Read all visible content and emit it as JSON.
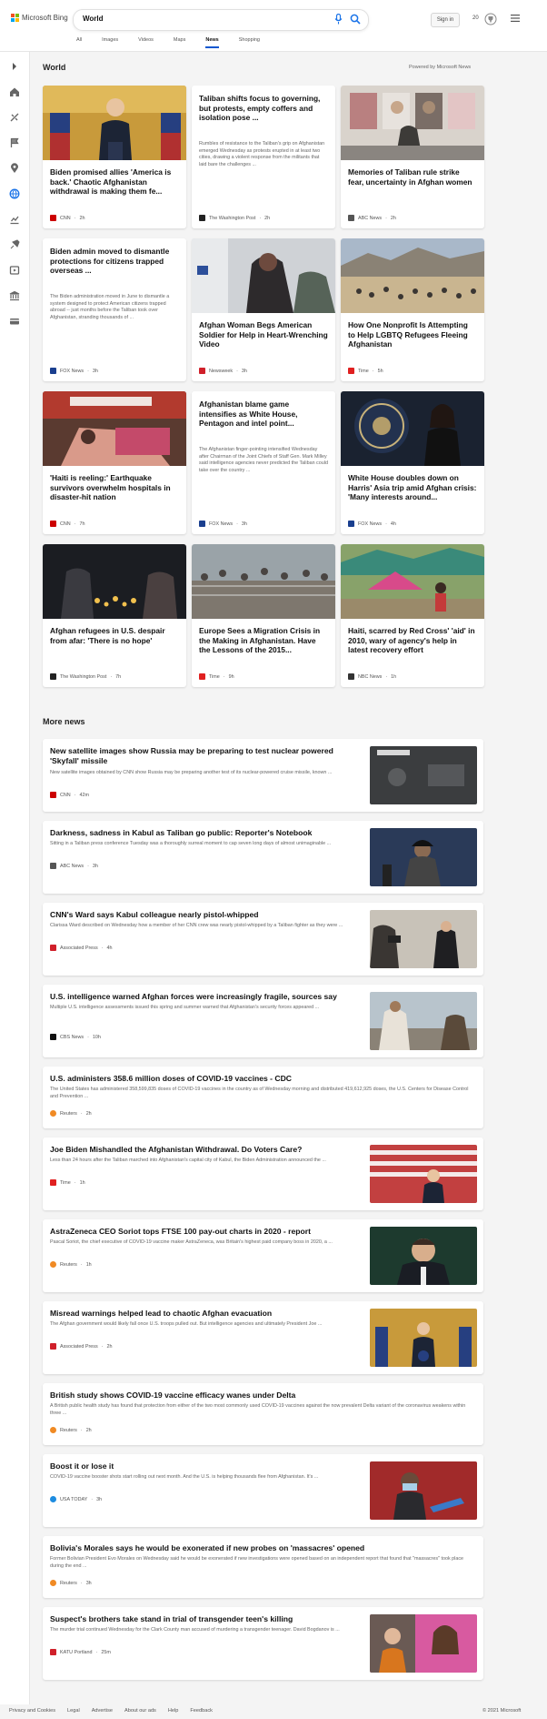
{
  "header": {
    "brand": "Microsoft Bing",
    "search_value": "World",
    "signin_label": "Sign in",
    "rewards_count": "20",
    "tabs": [
      "All",
      "Images",
      "Videos",
      "Maps",
      "News",
      "Shopping"
    ],
    "active_tab": "News"
  },
  "rail": {
    "icons": [
      "expand-icon",
      "home-icon",
      "sports-icon",
      "flag-icon",
      "location-icon",
      "world-icon",
      "business-icon",
      "science-icon",
      "entertainment-icon",
      "politics-icon",
      "money-icon"
    ]
  },
  "top": {
    "section_title": "World",
    "powered": "Powered by Microsoft News",
    "cards": [
      {
        "title": "Biden promised allies 'America is back.' Chaotic Afghanistan withdrawal is making them fe...",
        "source": "CNN",
        "time": "2h",
        "src_color": "#cc0000"
      },
      {
        "title": "Taliban shifts focus to governing, but protests, empty coffers and isolation pose ...",
        "snippet": "Rumbles of resistance to the Taliban's grip on Afghanistan emerged Wednesday as protests erupted in at least two cities, drawing a violent response from the militants that laid bare the challenges ...",
        "source": "The Washington Post",
        "time": "2h",
        "src_color": "#222222"
      },
      {
        "title": "Memories of Taliban rule strike fear, uncertainty in Afghan women",
        "source": "ABC News",
        "time": "2h",
        "src_color": "#555555"
      },
      {
        "title": "Biden admin moved to dismantle protections for citizens trapped overseas ...",
        "snippet": "The Biden administration moved in June to dismantle a system designed to protect American citizens trapped abroad -- just months before the Taliban took over Afghanistan, stranding thousands of ...",
        "source": "FOX News",
        "time": "3h",
        "src_color": "#1a3f8f"
      },
      {
        "title": "Afghan Woman Begs American Soldier for Help in Heart-Wrenching Video",
        "source": "Newsweek",
        "time": "3h",
        "src_color": "#d0202a"
      },
      {
        "title": "How One Nonprofit Is Attempting to Help LGBTQ Refugees Fleeing Afghanistan",
        "source": "Time",
        "time": "5h",
        "src_color": "#e02020"
      },
      {
        "title": "'Haiti is reeling:' Earthquake survivors overwhelm hospitals in disaster-hit nation",
        "source": "CNN",
        "time": "7h",
        "src_color": "#cc0000"
      },
      {
        "title": "Afghanistan blame game intensifies as White House, Pentagon and intel point...",
        "snippet": "The Afghanistan finger-pointing intensified Wednesday after Chairman of the Joint Chiefs of Staff Gen. Mark Milley said intelligence agencies never predicted the Taliban could take over the country ...",
        "source": "FOX News",
        "time": "3h",
        "src_color": "#1a3f8f"
      },
      {
        "title": "White House doubles down on Harris' Asia trip amid Afghan crisis: 'Many interests around...",
        "source": "FOX News",
        "time": "4h",
        "src_color": "#1a3f8f"
      },
      {
        "title": "Afghan refugees in U.S. despair from afar: 'There is no hope'",
        "source": "The Washington Post",
        "time": "7h",
        "src_color": "#222222"
      },
      {
        "title": "Europe Sees a Migration Crisis in the Making in Afghanistan. Have the Lessons of the 2015...",
        "source": "Time",
        "time": "9h",
        "src_color": "#e02020"
      },
      {
        "title": "Haiti, scarred by Red Cross' 'aid' in 2010, wary of agency's help in latest recovery effort",
        "source": "NBC News",
        "time": "1h",
        "src_color": "#333333"
      }
    ]
  },
  "more": {
    "section_title": "More news",
    "items": [
      {
        "title": "New satellite images show Russia may be preparing to test nuclear powered 'Skyfall' missile",
        "snippet": "New satellite images obtained by CNN show Russia may be preparing another test of its nuclear-powered cruise missile, known ...",
        "source": "CNN",
        "time": "42m",
        "src_color": "#cc0000"
      },
      {
        "title": "Darkness, sadness in Kabul as Taliban go public: Reporter's Notebook",
        "snippet": "Sitting in a Taliban press conference Tuesday was a thoroughly surreal moment to cap seven long days of almost unimaginable ...",
        "source": "ABC News",
        "time": "3h",
        "src_color": "#555555"
      },
      {
        "title": "CNN's Ward says Kabul colleague nearly pistol-whipped",
        "snippet": "Clarissa Ward described on Wednesday how a member of her CNN crew was nearly pistol-whipped by a Taliban fighter as they were ...",
        "source": "Associated Press",
        "time": "4h",
        "src_color": "#d0202a"
      },
      {
        "title": "U.S. intelligence warned Afghan forces were increasingly fragile, sources say",
        "snippet": "Multiple U.S. intelligence assessments issued this spring and summer warned that Afghanistan's security forces appeared ...",
        "source": "CBS News",
        "time": "10h",
        "src_color": "#111111"
      },
      {
        "title": "U.S. administers 358.6 million doses of COVID-19 vaccines - CDC",
        "snippet": "The United States has administered 358,599,835 doses of COVID-19 vaccines in the country as of Wednesday morning and distributed 419,612,925 doses, the U.S. Centers for Disease Control and Prevention ...",
        "source": "Reuters",
        "time": "2h",
        "src_color": "#f08a24"
      },
      {
        "title": "Joe Biden Mishandled the Afghanistan Withdrawal. Do Voters Care?",
        "snippet": "Less than 24 hours after the Taliban marched into Afghanistan's capital city of Kabul, the Biden Administration announced the ...",
        "source": "Time",
        "time": "1h",
        "src_color": "#e02020"
      },
      {
        "title": "AstraZeneca CEO Soriot tops FTSE 100 pay-out charts in 2020 - report",
        "snippet": "Pascal Soriot, the chief executive of COVID-19 vaccine maker AstraZeneca, was Britain's highest paid company boss in 2020, a ...",
        "source": "Reuters",
        "time": "1h",
        "src_color": "#f08a24"
      },
      {
        "title": "Misread warnings helped lead to chaotic Afghan evacuation",
        "snippet": "The Afghan government would likely fall once U.S. troops pulled out. But intelligence agencies and ultimately President Joe ...",
        "source": "Associated Press",
        "time": "2h",
        "src_color": "#d0202a"
      },
      {
        "title": "British study shows COVID-19 vaccine efficacy wanes under Delta",
        "snippet": "A British public health study has found that protection from either of the two most commonly used COVID-19 vaccines against the now prevalent Delta variant of the coronavirus weakens within three ...",
        "source": "Reuters",
        "time": "2h",
        "src_color": "#f08a24"
      },
      {
        "title": "Boost it or lose it",
        "snippet": "COVID-19 vaccine booster shots start rolling out next month. And the U.S. is helping thousands flee from Afghanistan. It's ...",
        "source": "USA TODAY",
        "time": "3h",
        "src_color": "#1d8ce0"
      },
      {
        "title": "Bolivia's Morales says he would be exonerated if new probes on 'massacres' opened",
        "snippet": "Former Bolivian President Evo Morales on Wednesday said he would be exonerated if new investigations were opened based on an independent report that found that \"massacres\" took place during the end ...",
        "source": "Reuters",
        "time": "3h",
        "src_color": "#f08a24"
      },
      {
        "title": "Suspect's brothers take stand in trial of transgender teen's killing",
        "snippet": "The murder trial continued Wednesday for the Clark County man accused of murdering a transgender teenager. David Bogdanov is ...",
        "source": "KATU Portland",
        "time": "25m",
        "src_color": "#d0202a"
      }
    ]
  },
  "footer": {
    "links": [
      "Privacy and Cookies",
      "Legal",
      "Advertise",
      "About our ads",
      "Help",
      "Feedback"
    ],
    "copyright": "© 2021 Microsoft"
  }
}
